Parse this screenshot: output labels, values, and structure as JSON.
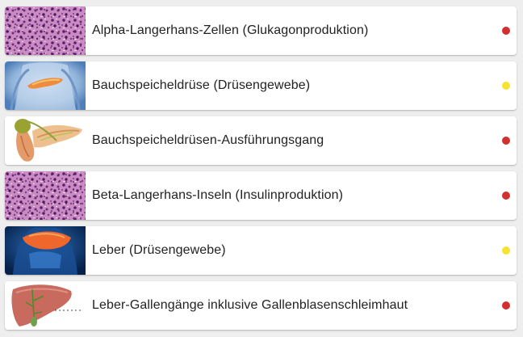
{
  "items": [
    {
      "label": "Alpha-Langerhans-Zellen (Glukagonproduktion)",
      "image": "histology-tissue-image",
      "status_color": "#d32f2f"
    },
    {
      "label": "Bauchspeicheldrüse (Drüsengewebe)",
      "image": "pancreas-body-image",
      "status_color": "#f5e231"
    },
    {
      "label": "Bauchspeicheldrüsen-Ausführungsgang",
      "image": "pancreas-duct-image",
      "status_color": "#d32f2f"
    },
    {
      "label": "Beta-Langerhans-Inseln (Insulinproduktion)",
      "image": "histology-tissue-image",
      "status_color": "#d32f2f"
    },
    {
      "label": "Leber (Drüsengewebe)",
      "image": "liver-body-image",
      "status_color": "#f5e231"
    },
    {
      "label": "Leber-Gallengänge inklusive Gallenblasenschleimhaut",
      "image": "liver-bile-duct-image",
      "status_color": "#d32f2f"
    }
  ]
}
